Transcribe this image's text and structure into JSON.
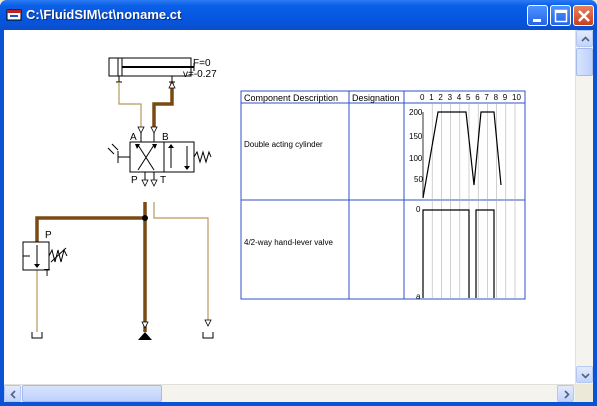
{
  "window": {
    "title": "C:\\FluidSIM\\ct\\noname.ct",
    "buttons": {
      "minimize": "minimize",
      "maximize": "maximize",
      "close": "close"
    }
  },
  "circuit": {
    "cylinder": {
      "force": "F=0",
      "velocity": "v=-0.27"
    },
    "valve": {
      "port_a": "A",
      "port_b": "B",
      "port_p": "P",
      "port_t": "T"
    },
    "relief_valve": {
      "port_p": "P",
      "port_t": "T"
    }
  },
  "state_diagram": {
    "headers": {
      "component": "Component Description",
      "designation": "Designation"
    },
    "time_ticks": [
      "0",
      "1",
      "2",
      "3",
      "4",
      "5",
      "6",
      "7",
      "8",
      "9",
      "10"
    ],
    "rows": [
      {
        "component": "Double acting cylinder",
        "designation": "",
        "levels": [
          "200",
          "150",
          "100",
          "50"
        ]
      },
      {
        "component": "4/2-way hand-lever valve",
        "designation": "",
        "levels": [
          "0",
          "a"
        ]
      }
    ]
  },
  "colors": {
    "titlebar": "#0656E0",
    "pipe_active": "#7A4A12",
    "pipe_idle": "#B89A5A",
    "grid_blue": "#3050C8"
  }
}
